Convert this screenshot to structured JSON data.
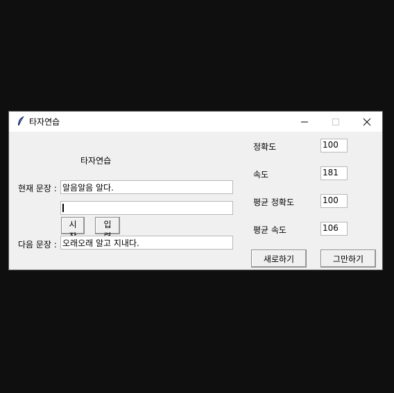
{
  "window": {
    "title": "타자연습",
    "minimize_icon": "minimize-icon",
    "maximize_icon": "maximize-icon",
    "close_icon": "close-icon"
  },
  "main": {
    "heading": "타자연습",
    "current_sentence_label": "현재 문장 :",
    "current_sentence_value": "알음알음 알다.",
    "typing_input_value": "",
    "start_button": "시작",
    "submit_button": "입력",
    "next_sentence_label": "다음 문장 :",
    "next_sentence_value": "오래오래 알고 지내다."
  },
  "stats": {
    "accuracy_label": "정확도",
    "accuracy_value": "100",
    "speed_label": "속도",
    "speed_value": "181",
    "avg_accuracy_label": "평균 정확도",
    "avg_accuracy_value": "100",
    "avg_speed_label": "평균 속도",
    "avg_speed_value": "106"
  },
  "actions": {
    "refresh_button": "새로하기",
    "quit_button": "그만하기"
  }
}
